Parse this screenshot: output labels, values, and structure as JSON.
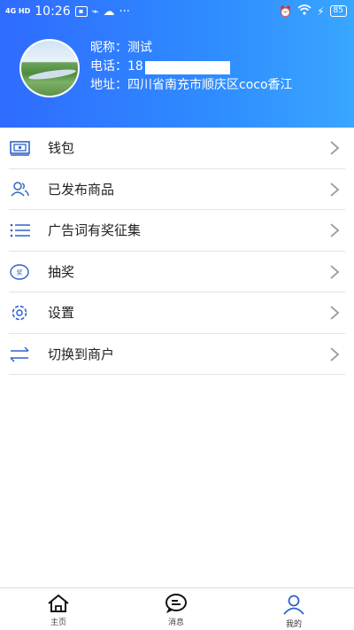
{
  "status_bar": {
    "signal_text": "4G HD",
    "time": "10:26",
    "battery": "85"
  },
  "profile": {
    "nickname_label": "昵称：",
    "nickname": "测试",
    "phone_label": "电话：",
    "phone_visible": "18",
    "address_label": "地址：",
    "address": "四川省南充市顺庆区coco香江"
  },
  "menu": {
    "items": [
      {
        "label": "钱包",
        "icon": "wallet-icon"
      },
      {
        "label": "已发布商品",
        "icon": "users-icon"
      },
      {
        "label": "广告词有奖征集",
        "icon": "list-icon"
      },
      {
        "label": "抽奖",
        "icon": "prize-icon"
      },
      {
        "label": "设置",
        "icon": "gear-icon"
      },
      {
        "label": "切换到商户",
        "icon": "switch-icon"
      }
    ]
  },
  "tabbar": {
    "tabs": [
      {
        "label": "主页",
        "icon": "home-icon"
      },
      {
        "label": "消息",
        "icon": "message-icon"
      },
      {
        "label": "我的",
        "icon": "profile-icon",
        "active": true
      }
    ]
  },
  "colors": {
    "header_start": "#2f6bff",
    "header_end": "#39a6ff",
    "icon_blue": "#2f63c8"
  }
}
